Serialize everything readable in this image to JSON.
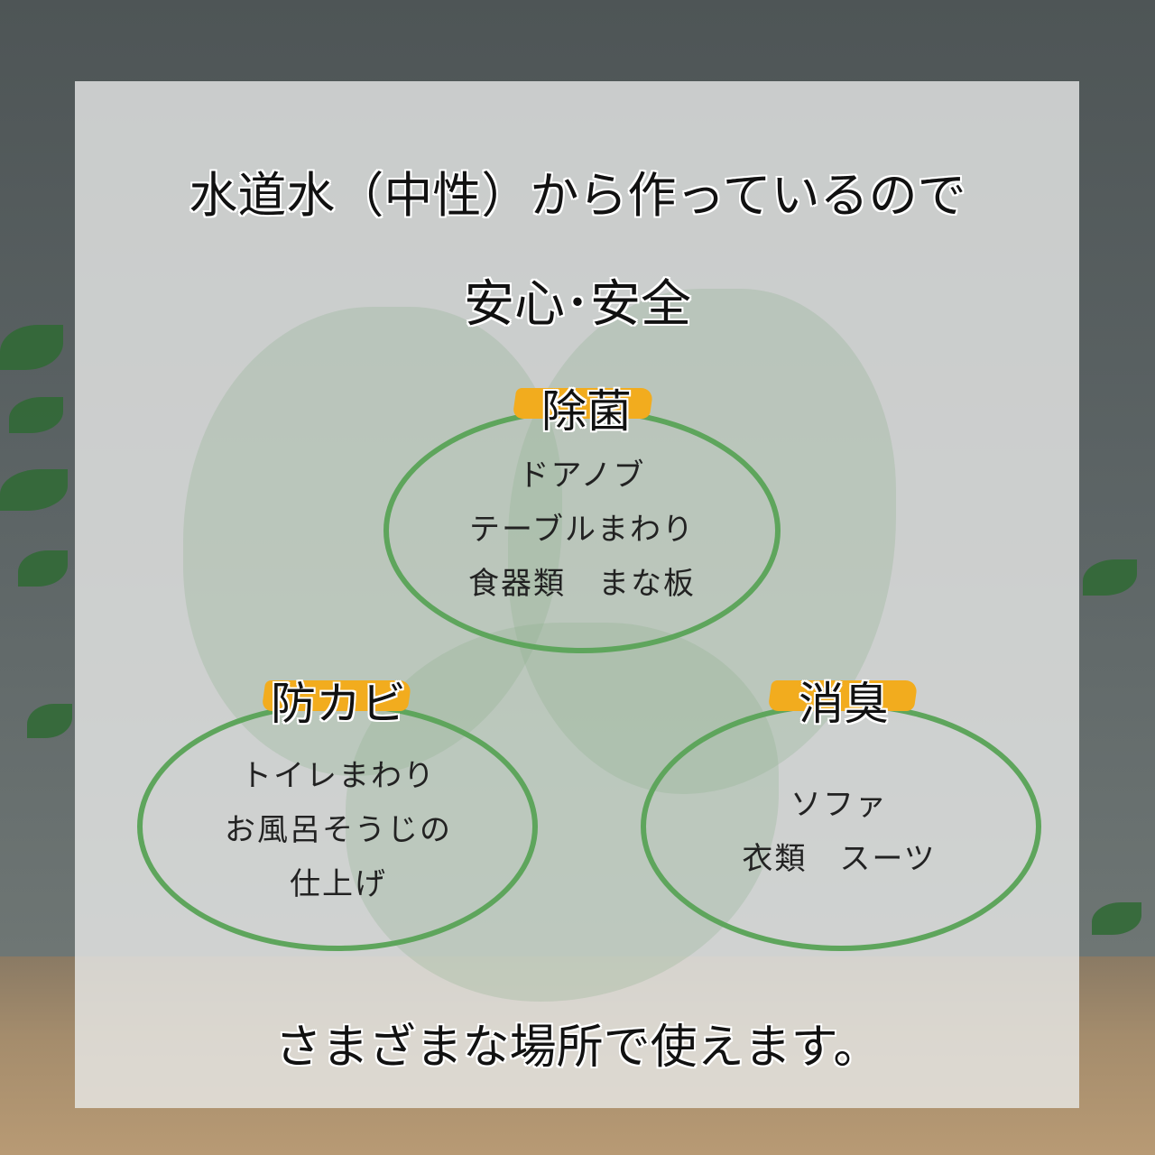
{
  "headline": "水道水（中性）から作っているので",
  "subheadline": "安心･安全",
  "sections": [
    {
      "label": "除菌",
      "items": [
        "ドアノブ",
        "テーブルまわり",
        "食器類　まな板"
      ]
    },
    {
      "label": "防カビ",
      "items": [
        "トイレまわり",
        "お風呂そうじの",
        "仕上げ"
      ]
    },
    {
      "label": "消臭",
      "items": [
        "ソファ",
        "衣類　スーツ"
      ]
    }
  ],
  "footer": "さまざまな場所で使えます。",
  "colors": {
    "ring": "#5ea55c",
    "highlight": "#f2ac1e",
    "panel": "#e8eae8"
  }
}
